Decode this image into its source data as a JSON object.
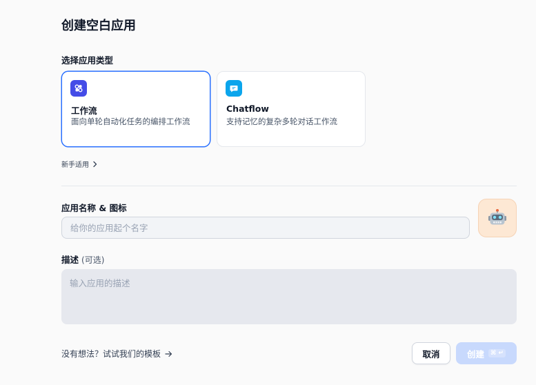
{
  "dialog": {
    "title": "创建空白应用"
  },
  "app_type": {
    "label": "选择应用类型",
    "options": [
      {
        "name": "工作流",
        "description": "面向单轮自动化任务的编排工作流",
        "icon": "workflow-icon",
        "color": "#444ce7",
        "selected": true
      },
      {
        "name": "Chatflow",
        "description": "支持记忆的复杂多轮对话工作流",
        "icon": "chatflow-icon",
        "color": "#0ba5ec",
        "selected": false
      }
    ],
    "beginner_link": "新手适用"
  },
  "app_name": {
    "label": "应用名称 & 图标",
    "placeholder": "给你的应用起个名字",
    "value": "",
    "avatar_icon": "robot-emoji-icon",
    "avatar_emoji": "🤖"
  },
  "description": {
    "label": "描述",
    "optional": "(可选)",
    "placeholder": "输入应用的描述",
    "value": ""
  },
  "footer": {
    "template_link": "没有想法？试试我们的模板",
    "cancel_label": "取消",
    "create_label": "创建",
    "create_shortcut": "⌘ ↵"
  },
  "colors": {
    "accent": "#2970ff",
    "create_disabled": "#c8d9fd",
    "avatar_bg": "#fde8d4"
  }
}
